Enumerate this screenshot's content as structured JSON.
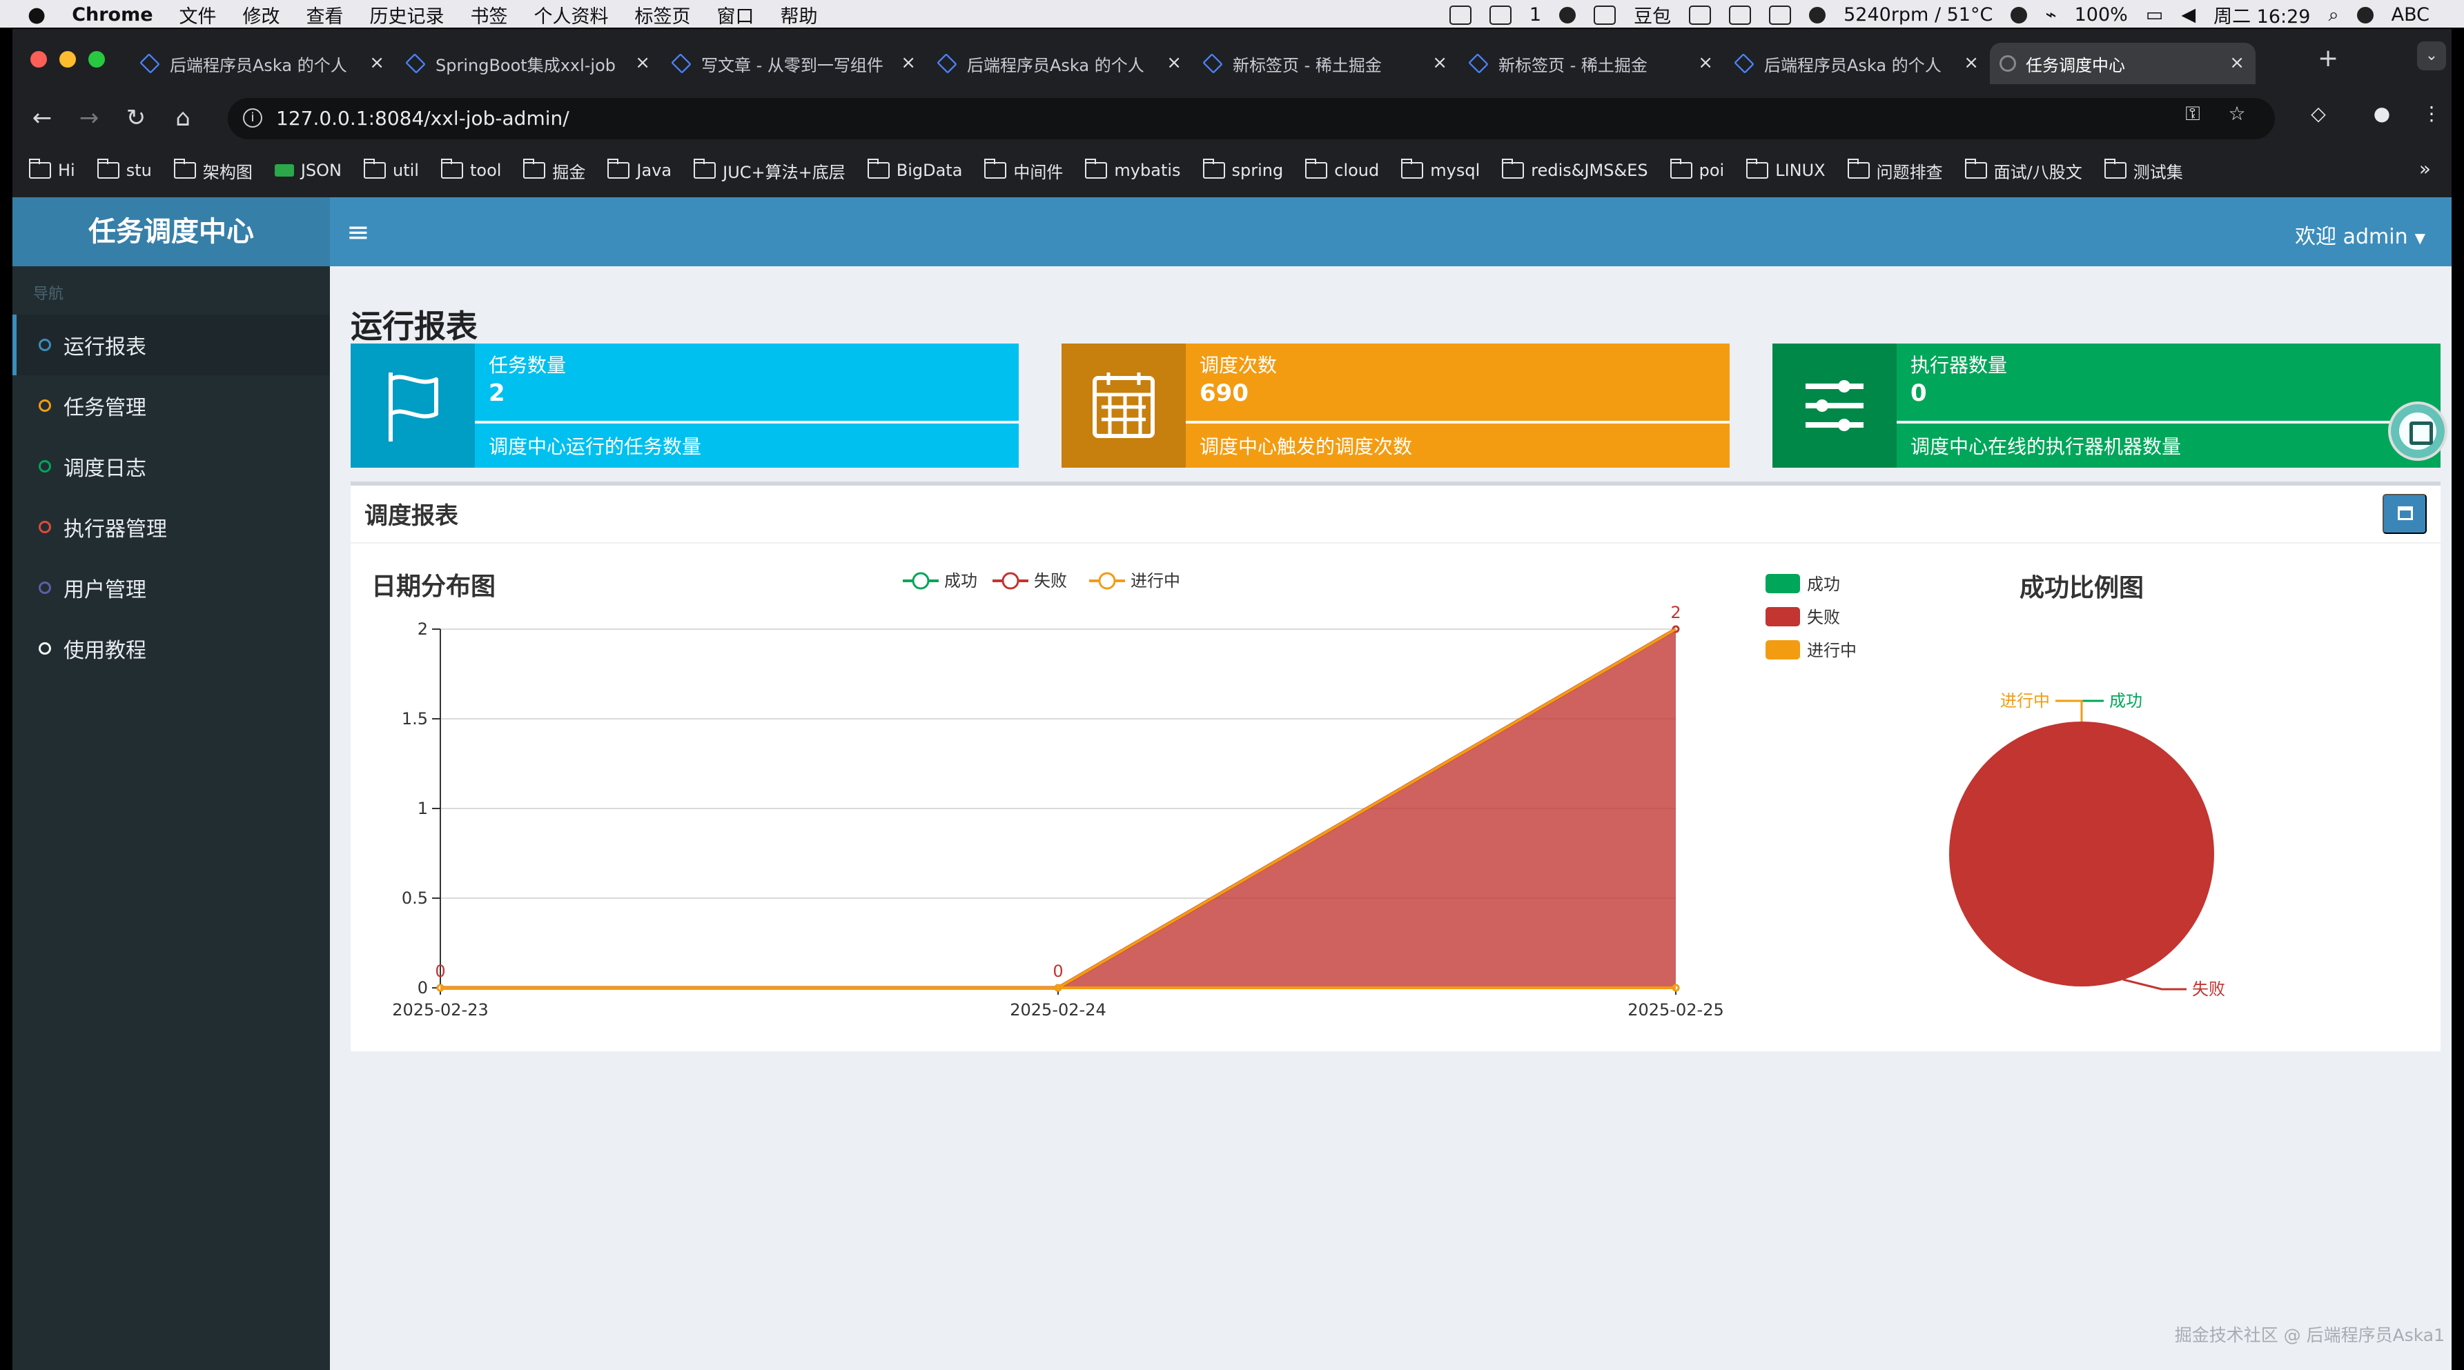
{
  "mac_menu": {
    "app": "Chrome",
    "items": [
      "文件",
      "修改",
      "查看",
      "历史记录",
      "书签",
      "个人资料",
      "标签页",
      "窗口",
      "帮助"
    ],
    "right_items": [
      "1",
      "豆包",
      "5240rpm / 51°C",
      "100%",
      "周二 16:29",
      "ABC"
    ]
  },
  "browser": {
    "tabs": [
      {
        "title": "后端程序员Aska 的个人"
      },
      {
        "title": "SpringBoot集成xxl-job"
      },
      {
        "title": "写文章 - 从零到一写组件"
      },
      {
        "title": "后端程序员Aska 的个人"
      },
      {
        "title": "新标签页 - 稀土掘金"
      },
      {
        "title": "新标签页 - 稀土掘金"
      },
      {
        "title": "后端程序员Aska 的个人"
      },
      {
        "title": "任务调度中心"
      }
    ],
    "url": "127.0.0.1:8084/xxl-job-admin/",
    "bookmarks": [
      "Hi",
      "stu",
      "架构图",
      "JSON",
      "util",
      "tool",
      "掘金",
      "Java",
      "JUC+算法+底层",
      "BigData",
      "中间件",
      "mybatis",
      "spring",
      "cloud",
      "mysql",
      "redis&JMS&ES",
      "poi",
      "LINUX",
      "问题排查",
      "面试/八股文",
      "测试集"
    ]
  },
  "app": {
    "brand": "任务调度中心",
    "welcome": "欢迎 admin",
    "nav_header": "导航",
    "menu": [
      {
        "label": "运行报表",
        "color": "#3c8dbc"
      },
      {
        "label": "任务管理",
        "color": "#f39c12"
      },
      {
        "label": "调度日志",
        "color": "#00a65a"
      },
      {
        "label": "执行器管理",
        "color": "#dd4b39"
      },
      {
        "label": "用户管理",
        "color": "#605ca8"
      },
      {
        "label": "使用教程",
        "color": "#f4f4f4"
      }
    ]
  },
  "page": {
    "title": "运行报表",
    "cards": [
      {
        "title": "任务数量",
        "value": "2",
        "desc": "调度中心运行的任务数量",
        "color": "#00c0ef",
        "icon": "flag-icon"
      },
      {
        "title": "调度次数",
        "value": "690",
        "desc": "调度中心触发的调度次数",
        "color": "#f39c12",
        "icon": "calendar-icon"
      },
      {
        "title": "执行器数量",
        "value": "0",
        "desc": "调度中心在线的执行器机器数量",
        "color": "#00a65a",
        "icon": "sliders-icon"
      }
    ],
    "report": {
      "title": "调度报表"
    },
    "watermark": "掘金技术社区 @ 后端程序员Aska1"
  },
  "chart_data": [
    {
      "type": "area",
      "title": "日期分布图",
      "categories": [
        "2025-02-23",
        "2025-02-24",
        "2025-02-25"
      ],
      "series": [
        {
          "name": "成功",
          "values": [
            0,
            0,
            0
          ],
          "color": "#00a65a"
        },
        {
          "name": "失败",
          "values": [
            0,
            0,
            2
          ],
          "color": "#c23531"
        },
        {
          "name": "进行中",
          "values": [
            0,
            0,
            0
          ],
          "color": "#f39c12"
        }
      ],
      "data_labels": [
        0,
        0,
        2
      ],
      "ylim": [
        0,
        2
      ],
      "yticks": [
        0,
        0.5,
        1,
        1.5,
        2
      ],
      "legend": "top-center",
      "grid": true
    },
    {
      "type": "pie",
      "title": "成功比例图",
      "labels": [
        "成功",
        "失败",
        "进行中"
      ],
      "values": [
        0,
        1,
        0
      ],
      "colors": [
        "#00a65a",
        "#c23531",
        "#f39c12"
      ],
      "legend": "top-left"
    }
  ]
}
